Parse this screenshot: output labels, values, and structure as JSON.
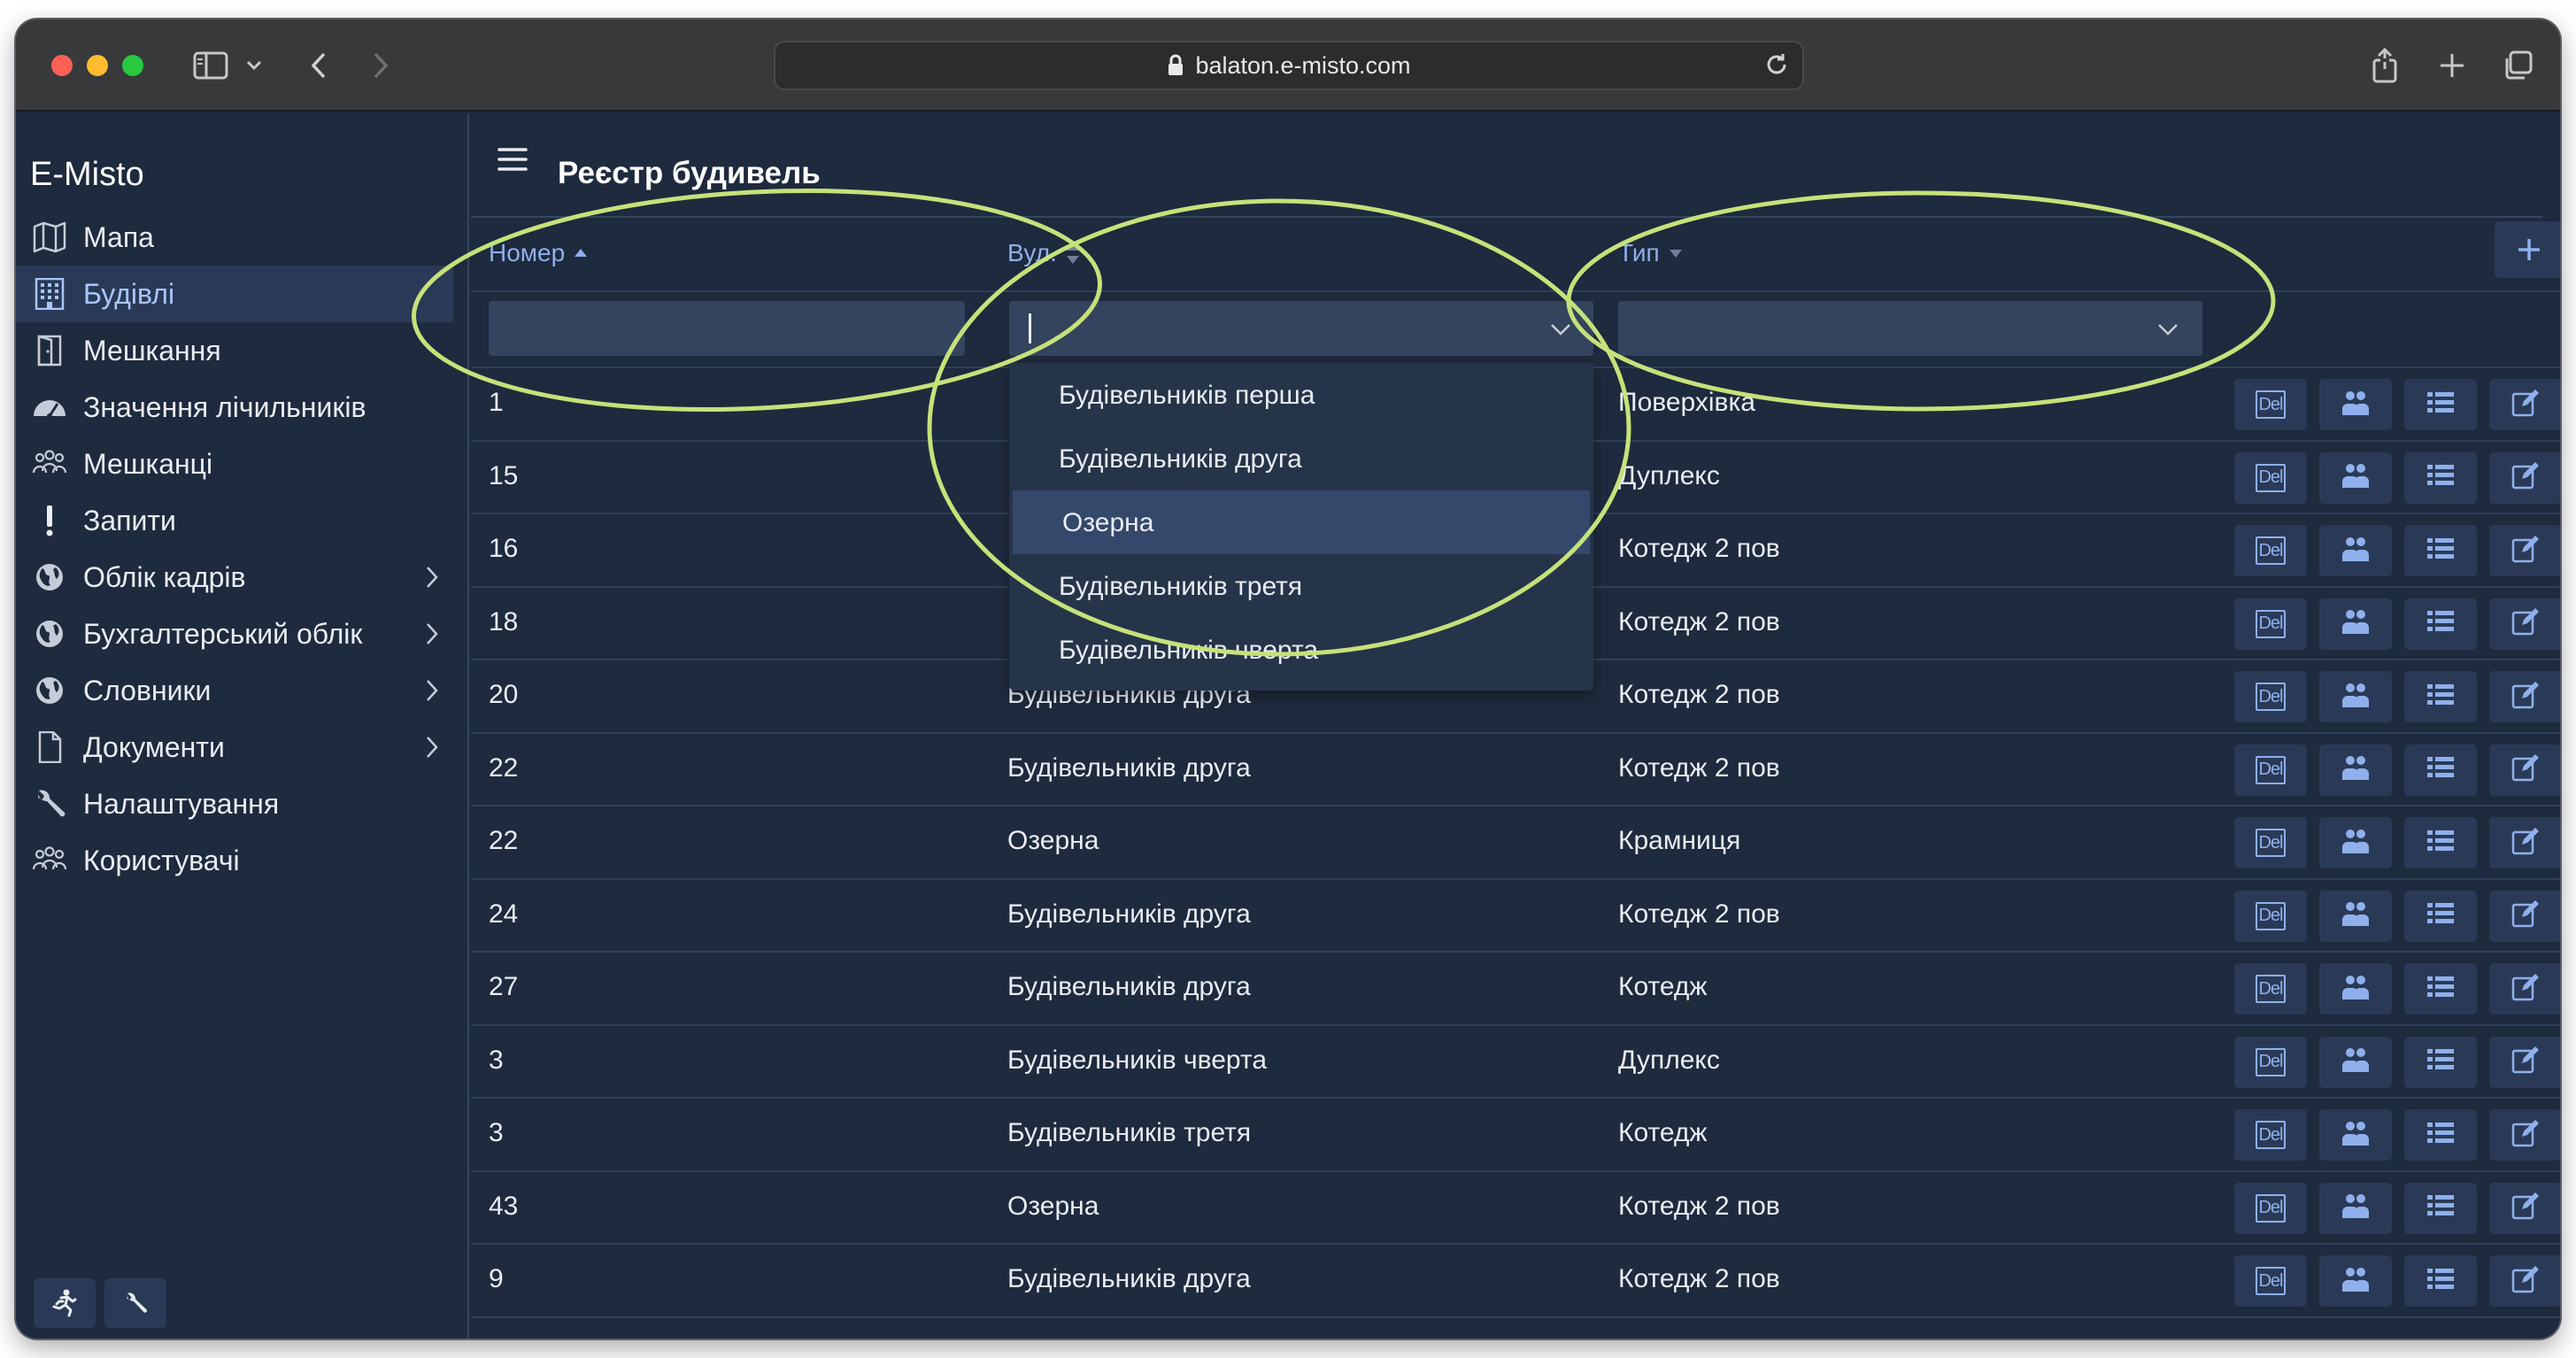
{
  "browser": {
    "url": "balaton.e-misto.com"
  },
  "sidebar": {
    "brand": "E-Misto",
    "items": [
      {
        "label": "Мапа",
        "icon": "map-icon",
        "active": false,
        "has_submenu": false
      },
      {
        "label": "Будівлі",
        "icon": "building-icon",
        "active": true,
        "has_submenu": false
      },
      {
        "label": "Мешкання",
        "icon": "door-icon",
        "active": false,
        "has_submenu": false
      },
      {
        "label": "Значення лічильників",
        "icon": "gauge-icon",
        "active": false,
        "has_submenu": false
      },
      {
        "label": "Мешканці",
        "icon": "people-icon",
        "active": false,
        "has_submenu": false
      },
      {
        "label": "Запити",
        "icon": "exclamation-icon",
        "active": false,
        "has_submenu": false
      },
      {
        "label": "Облік кадрів",
        "icon": "globe-icon",
        "active": false,
        "has_submenu": true
      },
      {
        "label": "Бухгалтерський облік",
        "icon": "globe-icon",
        "active": false,
        "has_submenu": true
      },
      {
        "label": "Словники",
        "icon": "globe-icon",
        "active": false,
        "has_submenu": true
      },
      {
        "label": "Документи",
        "icon": "document-icon",
        "active": false,
        "has_submenu": true
      },
      {
        "label": "Налаштування",
        "icon": "wrench-icon",
        "active": false,
        "has_submenu": false
      },
      {
        "label": "Користувачі",
        "icon": "people-icon",
        "active": false,
        "has_submenu": false
      }
    ],
    "footer_buttons": [
      "running-person-icon",
      "wrench-icon"
    ]
  },
  "main": {
    "title": "Реєстр будивель",
    "columns": {
      "number": "Номер",
      "street": "Вул.",
      "type": "Тип"
    },
    "add_label": "+",
    "del_label": "Del"
  },
  "street_dropdown": {
    "options": [
      "Будівельників перша",
      "Будівельників друга",
      "Озерна",
      "Будівельників третя",
      "Будівельників чверта"
    ],
    "highlighted": "Озерна"
  },
  "rows": [
    {
      "number": "1",
      "street": "",
      "type": "Поверхівка"
    },
    {
      "number": "15",
      "street": "",
      "type": "Дуплекс"
    },
    {
      "number": "16",
      "street": "",
      "type": "Котедж 2 пов"
    },
    {
      "number": "18",
      "street": "",
      "type": "Котедж 2 пов"
    },
    {
      "number": "20",
      "street": "Будівельників друга",
      "type": "Котедж 2 пов"
    },
    {
      "number": "22",
      "street": "Будівельників друга",
      "type": "Котедж 2 пов"
    },
    {
      "number": "22",
      "street": "Озерна",
      "type": "Крамниця"
    },
    {
      "number": "24",
      "street": "Будівельників друга",
      "type": "Котедж 2 пов"
    },
    {
      "number": "27",
      "street": "Будівельників друга",
      "type": "Котедж"
    },
    {
      "number": "3",
      "street": "Будівельників чверта",
      "type": "Дуплекс"
    },
    {
      "number": "3",
      "street": "Будівельників третя",
      "type": "Котедж"
    },
    {
      "number": "43",
      "street": "Озерна",
      "type": "Котедж 2 пов"
    },
    {
      "number": "9",
      "street": "Будівельників друга",
      "type": "Котедж 2 пов"
    }
  ],
  "row_action_icons": [
    "del-icon",
    "residents-icon",
    "list-icon",
    "edit-icon"
  ],
  "colors": {
    "background": "#1e2a3d",
    "accent": "#8fb0ec",
    "annotation": "#c5e27a"
  }
}
